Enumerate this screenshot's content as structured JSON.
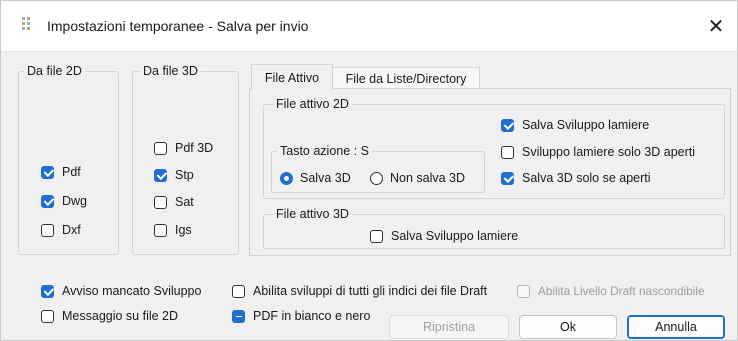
{
  "window": {
    "title": "Impostazioni temporanee - Salva per invio",
    "close_glyph": "✕"
  },
  "group_2d": {
    "legend": "Da file 2D",
    "items": [
      {
        "label": "Pdf",
        "checked": true
      },
      {
        "label": "Dwg",
        "checked": true
      },
      {
        "label": "Dxf",
        "checked": false
      }
    ]
  },
  "group_3d": {
    "legend": "Da file 3D",
    "items": [
      {
        "label": "Pdf 3D",
        "checked": false
      },
      {
        "label": "Stp",
        "checked": true
      },
      {
        "label": "Sat",
        "checked": false
      },
      {
        "label": "Igs",
        "checked": false
      }
    ]
  },
  "tabs": [
    {
      "label": "File Attivo",
      "active": true
    },
    {
      "label": "File da Liste/Directory",
      "active": false
    }
  ],
  "file_attivo_2d": {
    "legend": "File attivo 2D",
    "tasto_azione": {
      "legend": "Tasto azione : S",
      "radios": [
        {
          "label": "Salva 3D",
          "selected": true
        },
        {
          "label": "Non salva 3D",
          "selected": false
        }
      ]
    },
    "options": [
      {
        "label": "Salva Sviluppo lamiere",
        "checked": true
      },
      {
        "label": "Sviluppo lamiere solo 3D aperti",
        "checked": false
      },
      {
        "label": "Salva 3D solo se aperti",
        "checked": true
      }
    ]
  },
  "file_attivo_3d": {
    "legend": "File attivo 3D",
    "option": {
      "label": "Salva Sviluppo lamiere",
      "checked": false
    }
  },
  "bottom": {
    "avviso": {
      "label": "Avviso mancato Sviluppo",
      "checked": true
    },
    "messaggio": {
      "label": "Messaggio su file 2D",
      "checked": false
    },
    "abilita_sviluppi": {
      "label": "Abilita sviluppi di tutti gli indici dei file Draft",
      "checked": false
    },
    "pdf_bn": {
      "label": "PDF in bianco e nero",
      "state": "indeterminate"
    },
    "abilita_livello": {
      "label": "Abilita Livello Draft nascondibile",
      "checked": false,
      "disabled": true
    }
  },
  "buttons": {
    "ripristina": "Ripristina",
    "ok": "Ok",
    "annulla": "Annulla"
  },
  "colors": {
    "accent": "#1f6fd0"
  },
  "icons": {
    "title_icon": "app-settings-icon",
    "close_icon": "close-icon"
  }
}
